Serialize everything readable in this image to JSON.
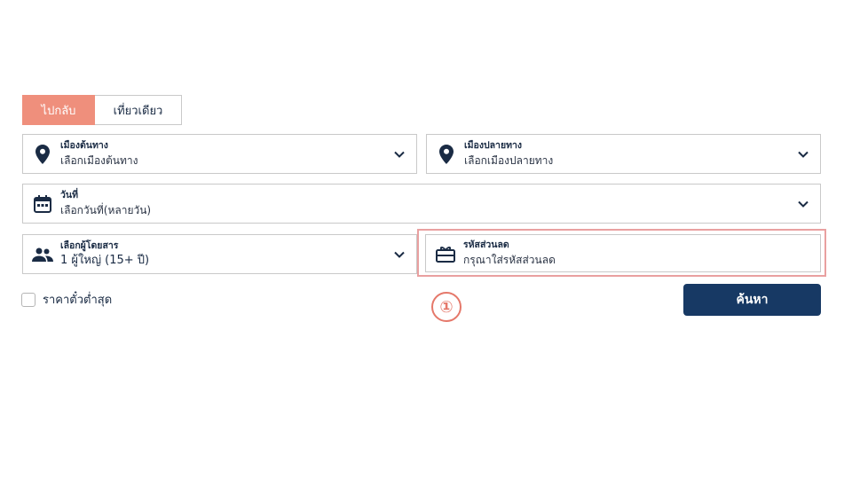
{
  "trip_tabs": {
    "round_trip": "ไปกลับ",
    "one_way": "เที่ยวเดียว"
  },
  "origin": {
    "label": "เมืองต้นทาง",
    "value": "เลือกเมืองต้นทาง",
    "icon": "location-pin-icon"
  },
  "destination": {
    "label": "เมืองปลายทาง",
    "value": "เลือกเมืองปลายทาง",
    "icon": "location-pin-icon"
  },
  "date": {
    "label": "วันที่",
    "value": "เลือกวันที่(หลายวัน)",
    "icon": "calendar-icon"
  },
  "passengers": {
    "label": "เลือกผู้โดยสาร",
    "value": "1 ผู้ใหญ่ (15+ ปี)",
    "icon": "people-icon"
  },
  "promo": {
    "label": "รหัสส่วนลด",
    "placeholder": "กรุณาใส่รหัสส่วนลด",
    "icon": "ticket-icon"
  },
  "lowest_fare": {
    "label": "ราคาตั๋วต่ำสุด",
    "checked": false
  },
  "search_button": "ค้นหา",
  "annotation_step": "①",
  "colors": {
    "accent": "#ef8f7c",
    "primary": "#173964",
    "highlight": "#e9a0a0"
  }
}
